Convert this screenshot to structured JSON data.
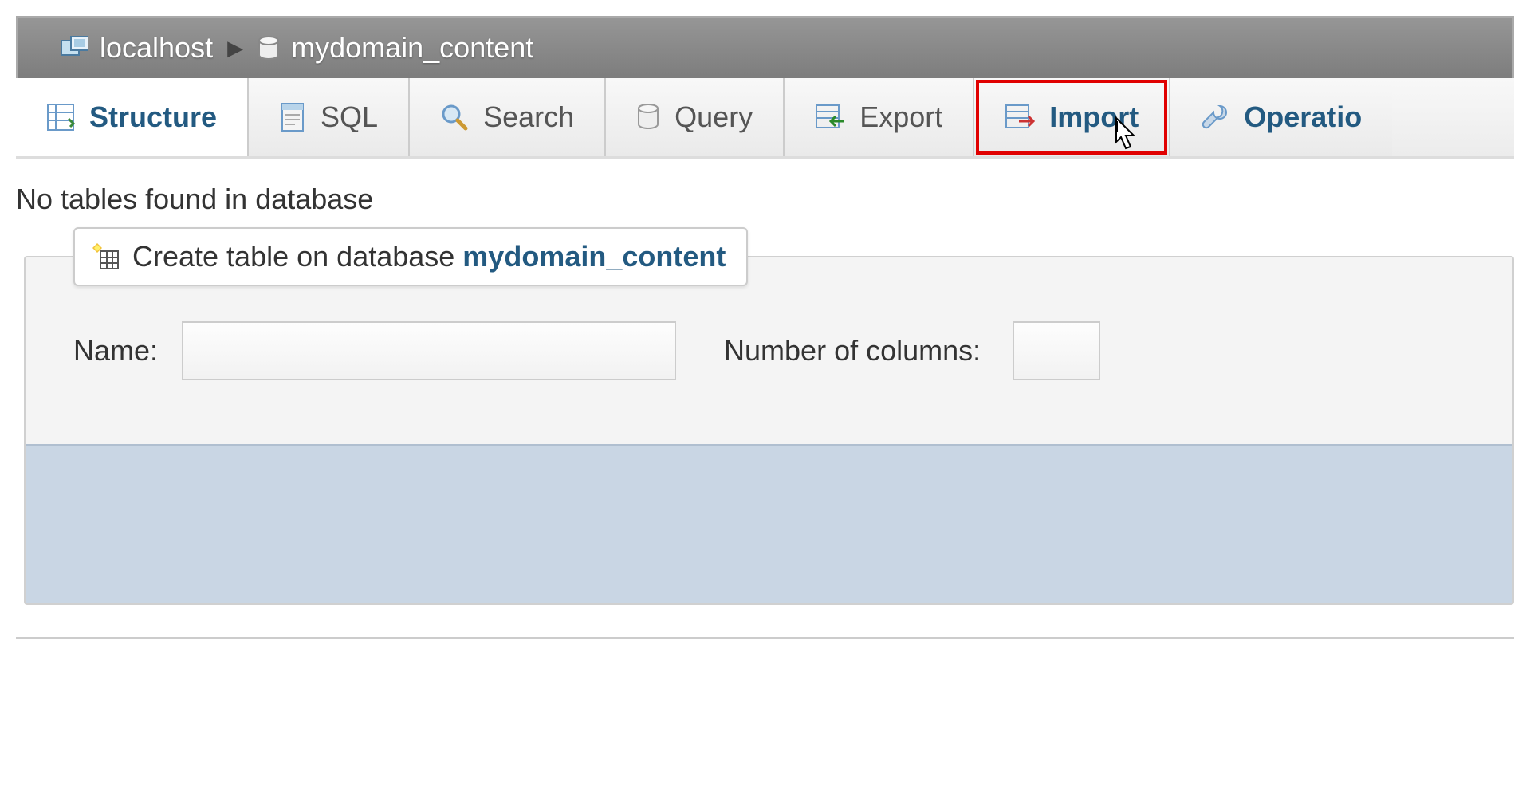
{
  "breadcrumb": {
    "server": "localhost",
    "database": "mydomain_content"
  },
  "tabs": {
    "structure": "Structure",
    "sql": "SQL",
    "search": "Search",
    "query": "Query",
    "export": "Export",
    "import": "Import",
    "operations": "Operatio"
  },
  "message": "No tables found in database",
  "create": {
    "legend_prefix": "Create table on database",
    "db_name": "mydomain_content",
    "name_label": "Name:",
    "cols_label": "Number of columns:"
  }
}
